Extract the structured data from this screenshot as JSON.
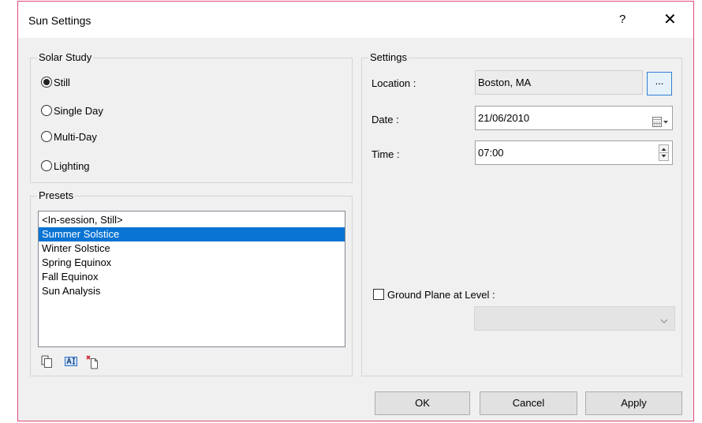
{
  "window": {
    "title": "Sun Settings",
    "help": "?",
    "close": "✕"
  },
  "solar_study": {
    "legend": "Solar Study",
    "options": [
      "Still",
      "Single Day",
      "Multi-Day",
      "Lighting"
    ],
    "selected": "Still"
  },
  "presets": {
    "legend": "Presets",
    "items": [
      "<In-session, Still>",
      "Summer Solstice",
      "Winter Solstice",
      "Spring Equinox",
      "Fall Equinox",
      "Sun Analysis"
    ],
    "selected": "Summer Solstice",
    "toolbar_icons": [
      "duplicate-icon",
      "rename-icon",
      "delete-icon"
    ]
  },
  "settings": {
    "legend": "Settings",
    "location_label": "Location :",
    "location_value": "Boston, MA",
    "browse_label": "...",
    "date_label": "Date :",
    "date_value": "21/06/2010",
    "time_label": "Time :",
    "time_value": "07:00",
    "ground_plane_label": "Ground Plane at Level :",
    "ground_plane_checked": false,
    "level_value": ""
  },
  "buttons": {
    "ok": "OK",
    "cancel": "Cancel",
    "apply": "Apply"
  },
  "colors": {
    "selection": "#0a74d4",
    "browse_border": "#2f7fd1",
    "window_border": "#e2487d"
  }
}
